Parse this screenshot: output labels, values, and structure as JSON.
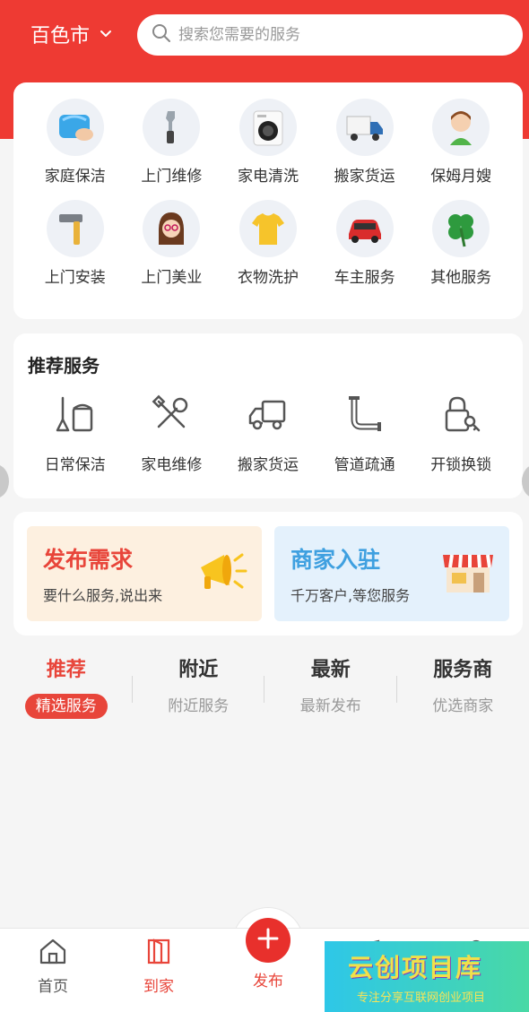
{
  "header": {
    "city": "百色市",
    "search_placeholder": "搜索您需要的服务"
  },
  "categories": [
    {
      "label": "家庭保洁",
      "icon": "cleaning-cloth-icon"
    },
    {
      "label": "上门维修",
      "icon": "wrench-icon"
    },
    {
      "label": "家电清洗",
      "icon": "washing-machine-icon"
    },
    {
      "label": "搬家货运",
      "icon": "truck-icon"
    },
    {
      "label": "保姆月嫂",
      "icon": "nanny-icon"
    },
    {
      "label": "上门安装",
      "icon": "hammer-icon"
    },
    {
      "label": "上门美业",
      "icon": "beauty-girl-icon"
    },
    {
      "label": "衣物洗护",
      "icon": "tshirt-icon"
    },
    {
      "label": "车主服务",
      "icon": "car-icon"
    },
    {
      "label": "其他服务",
      "icon": "clover-icon"
    }
  ],
  "recommended": {
    "title": "推荐服务",
    "items": [
      {
        "label": "日常保洁",
        "icon": "broom-bucket-icon"
      },
      {
        "label": "家电维修",
        "icon": "tools-icon"
      },
      {
        "label": "搬家货运",
        "icon": "delivery-truck-icon"
      },
      {
        "label": "管道疏通",
        "icon": "pipe-icon"
      },
      {
        "label": "开锁换锁",
        "icon": "lock-key-icon"
      }
    ]
  },
  "promos": [
    {
      "title": "发布需求",
      "subtitle": "要什么服务,说出来",
      "icon": "megaphone-icon"
    },
    {
      "title": "商家入驻",
      "subtitle": "千万客户,等您服务",
      "icon": "storefront-icon"
    }
  ],
  "tabs": [
    {
      "title": "推荐",
      "subtitle": "精选服务",
      "active": true
    },
    {
      "title": "附近",
      "subtitle": "附近服务",
      "active": false
    },
    {
      "title": "最新",
      "subtitle": "最新发布",
      "active": false
    },
    {
      "title": "服务商",
      "subtitle": "优选商家",
      "active": false
    }
  ],
  "bottom_nav": {
    "home": "首页",
    "daojia": "到家",
    "publish": "发布"
  },
  "watermark": {
    "title": "云创项目库",
    "subtitle": "专注分享互联网创业项目"
  },
  "colors": {
    "brand_red": "#ee3a33",
    "active_red": "#e8453a"
  }
}
